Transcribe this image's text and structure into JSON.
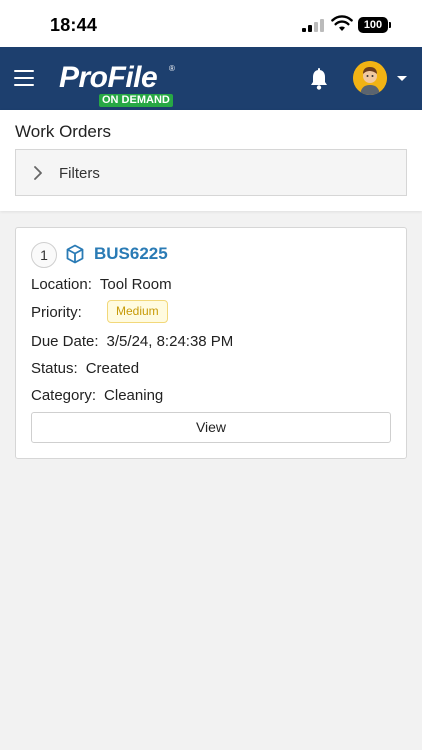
{
  "status_bar": {
    "time": "18:44",
    "battery": "100"
  },
  "header": {
    "logo_main": "ProFile",
    "logo_reg": "®",
    "logo_badge": "ON DEMAND"
  },
  "page": {
    "title": "Work Orders",
    "filters_label": "Filters"
  },
  "work_orders": [
    {
      "index": "1",
      "id": "BUS6225",
      "location_label": "Location:",
      "location": "Tool Room",
      "priority_label": "Priority:",
      "priority": "Medium",
      "due_label": "Due Date:",
      "due_date": "3/5/24, 8:24:38 PM",
      "status_label": "Status:",
      "status": "Created",
      "category_label": "Category:",
      "category": "Cleaning",
      "view_label": "View"
    }
  ],
  "colors": {
    "header_bg": "#1d3f6e",
    "badge_green": "#27a844",
    "link_blue": "#2a7bb5",
    "priority_text": "#c79a08",
    "avatar_bg": "#f2b314"
  },
  "icons": [
    "menu-icon",
    "bell-icon",
    "avatar",
    "chevron-right-icon",
    "box-icon",
    "signal-icon",
    "wifi-icon",
    "battery-icon"
  ]
}
